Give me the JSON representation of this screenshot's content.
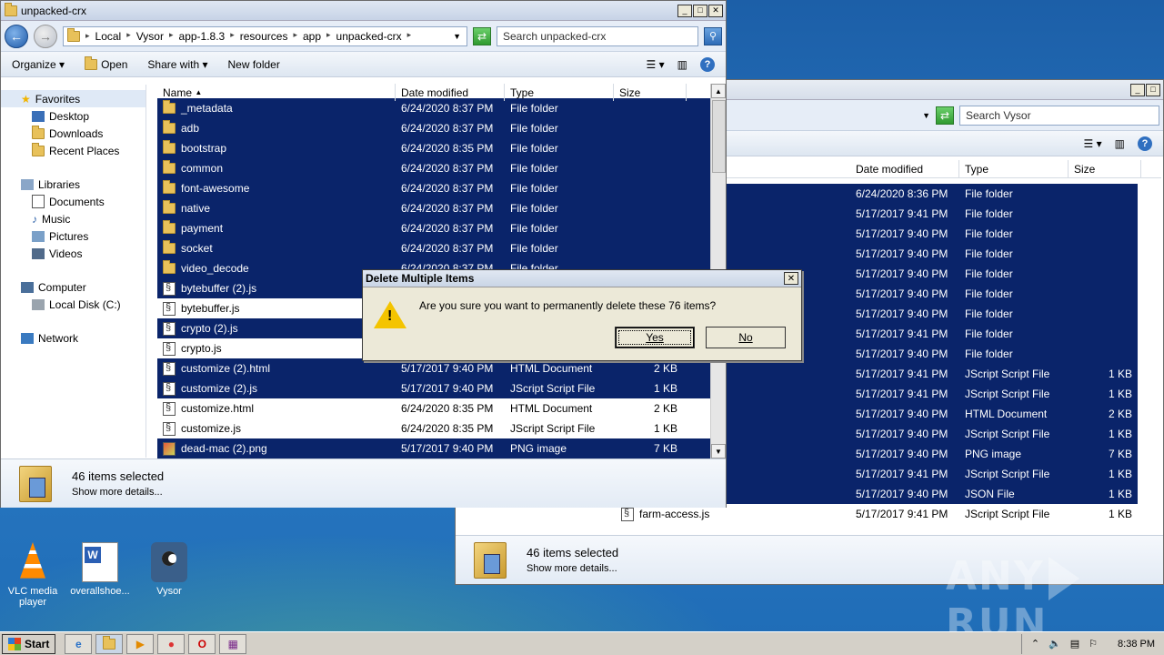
{
  "main_window": {
    "title": "unpacked-crx",
    "breadcrumb": [
      "Local",
      "Vysor",
      "app-1.8.3",
      "resources",
      "app",
      "unpacked-crx"
    ],
    "search_placeholder": "Search unpacked-crx",
    "toolbar": {
      "organize": "Organize",
      "open": "Open",
      "share_with": "Share with",
      "new_folder": "New folder"
    },
    "columns": {
      "name": "Name",
      "date": "Date modified",
      "type": "Type",
      "size": "Size"
    },
    "nav": {
      "favorites": "Favorites",
      "desktop": "Desktop",
      "downloads": "Downloads",
      "recent": "Recent Places",
      "libraries": "Libraries",
      "documents": "Documents",
      "music": "Music",
      "pictures": "Pictures",
      "videos": "Videos",
      "computer": "Computer",
      "local_disk": "Local Disk (C:)",
      "network": "Network"
    },
    "rows": [
      {
        "name": "_metadata",
        "date": "6/24/2020 8:37 PM",
        "type": "File folder",
        "size": "",
        "icon": "folder",
        "sel": true
      },
      {
        "name": "adb",
        "date": "6/24/2020 8:37 PM",
        "type": "File folder",
        "size": "",
        "icon": "folder",
        "sel": true
      },
      {
        "name": "bootstrap",
        "date": "6/24/2020 8:35 PM",
        "type": "File folder",
        "size": "",
        "icon": "folder",
        "sel": true
      },
      {
        "name": "common",
        "date": "6/24/2020 8:37 PM",
        "type": "File folder",
        "size": "",
        "icon": "folder",
        "sel": true
      },
      {
        "name": "font-awesome",
        "date": "6/24/2020 8:37 PM",
        "type": "File folder",
        "size": "",
        "icon": "folder",
        "sel": true
      },
      {
        "name": "native",
        "date": "6/24/2020 8:37 PM",
        "type": "File folder",
        "size": "",
        "icon": "folder",
        "sel": true
      },
      {
        "name": "payment",
        "date": "6/24/2020 8:37 PM",
        "type": "File folder",
        "size": "",
        "icon": "folder",
        "sel": true
      },
      {
        "name": "socket",
        "date": "6/24/2020 8:37 PM",
        "type": "File folder",
        "size": "",
        "icon": "folder",
        "sel": true
      },
      {
        "name": "video_decode",
        "date": "6/24/2020 8:37 PM",
        "type": "File folder",
        "size": "",
        "icon": "folder",
        "sel": true
      },
      {
        "name": "bytebuffer (2).js",
        "date": "",
        "type": "",
        "size": "",
        "icon": "js",
        "sel": true
      },
      {
        "name": "bytebuffer.js",
        "date": "",
        "type": "",
        "size": "",
        "icon": "js",
        "sel": false
      },
      {
        "name": "crypto (2).js",
        "date": "",
        "type": "",
        "size": "",
        "icon": "js",
        "sel": true
      },
      {
        "name": "crypto.js",
        "date": "",
        "type": "",
        "size": "",
        "icon": "js",
        "sel": false
      },
      {
        "name": "customize (2).html",
        "date": "5/17/2017 9:40 PM",
        "type": "HTML Document",
        "size": "2 KB",
        "icon": "js",
        "sel": true
      },
      {
        "name": "customize (2).js",
        "date": "5/17/2017 9:40 PM",
        "type": "JScript Script File",
        "size": "1 KB",
        "icon": "js",
        "sel": true
      },
      {
        "name": "customize.html",
        "date": "6/24/2020 8:35 PM",
        "type": "HTML Document",
        "size": "2 KB",
        "icon": "js",
        "sel": false
      },
      {
        "name": "customize.js",
        "date": "6/24/2020 8:35 PM",
        "type": "JScript Script File",
        "size": "1 KB",
        "icon": "js",
        "sel": false
      },
      {
        "name": "dead-mac (2).png",
        "date": "5/17/2017 9:40 PM",
        "type": "PNG image",
        "size": "7 KB",
        "icon": "img",
        "sel": true
      }
    ],
    "status_count": "46 items selected",
    "status_details": "Show more details..."
  },
  "back_window": {
    "search_placeholder": "Search Vysor",
    "columns": {
      "date": "Date modified",
      "type": "Type",
      "size": "Size"
    },
    "rows": [
      {
        "name": "",
        "date": "6/24/2020 8:36 PM",
        "type": "File folder",
        "size": ""
      },
      {
        "name": "",
        "date": "5/17/2017 9:41 PM",
        "type": "File folder",
        "size": ""
      },
      {
        "name": "",
        "date": "5/17/2017 9:40 PM",
        "type": "File folder",
        "size": ""
      },
      {
        "name": "",
        "date": "5/17/2017 9:40 PM",
        "type": "File folder",
        "size": ""
      },
      {
        "name": "",
        "date": "5/17/2017 9:40 PM",
        "type": "File folder",
        "size": ""
      },
      {
        "name": "",
        "date": "5/17/2017 9:40 PM",
        "type": "File folder",
        "size": ""
      },
      {
        "name": "",
        "date": "5/17/2017 9:40 PM",
        "type": "File folder",
        "size": ""
      },
      {
        "name": "",
        "date": "5/17/2017 9:41 PM",
        "type": "File folder",
        "size": ""
      },
      {
        "name": "",
        "date": "5/17/2017 9:40 PM",
        "type": "File folder",
        "size": ""
      },
      {
        "name": "",
        "date": "5/17/2017 9:41 PM",
        "type": "JScript Script File",
        "size": "1 KB"
      },
      {
        "name": "",
        "date": "5/17/2017 9:41 PM",
        "type": "JScript Script File",
        "size": "1 KB"
      },
      {
        "name": "",
        "date": "5/17/2017 9:40 PM",
        "type": "HTML Document",
        "size": "2 KB"
      },
      {
        "name": "",
        "date": "5/17/2017 9:40 PM",
        "type": "JScript Script File",
        "size": "1 KB"
      },
      {
        "name": "",
        "date": "5/17/2017 9:40 PM",
        "type": "PNG image",
        "size": "7 KB"
      },
      {
        "name": "",
        "date": "5/17/2017 9:41 PM",
        "type": "JScript Script File",
        "size": "1 KB"
      },
      {
        "name": "",
        "date": "5/17/2017 9:40 PM",
        "type": "JSON File",
        "size": "1 KB"
      },
      {
        "name": "farm-access.js",
        "date": "5/17/2017 9:41 PM",
        "type": "JScript Script File",
        "size": "1 KB"
      }
    ],
    "status_count": "46 items selected",
    "status_details": "Show more details..."
  },
  "dialog": {
    "title": "Delete Multiple Items",
    "message": "Are you sure you want to permanently delete these 76 items?",
    "yes": "Yes",
    "no": "No"
  },
  "desktop_icons": [
    {
      "label": "VLC media player",
      "icon": "vlc-icon"
    },
    {
      "label": "overallshoe...",
      "icon": "word-doc-icon"
    },
    {
      "label": "Vysor",
      "icon": "vysor-icon"
    }
  ],
  "taskbar": {
    "start": "Start",
    "clock": "8:38 PM"
  },
  "watermark": "ANY RUN"
}
